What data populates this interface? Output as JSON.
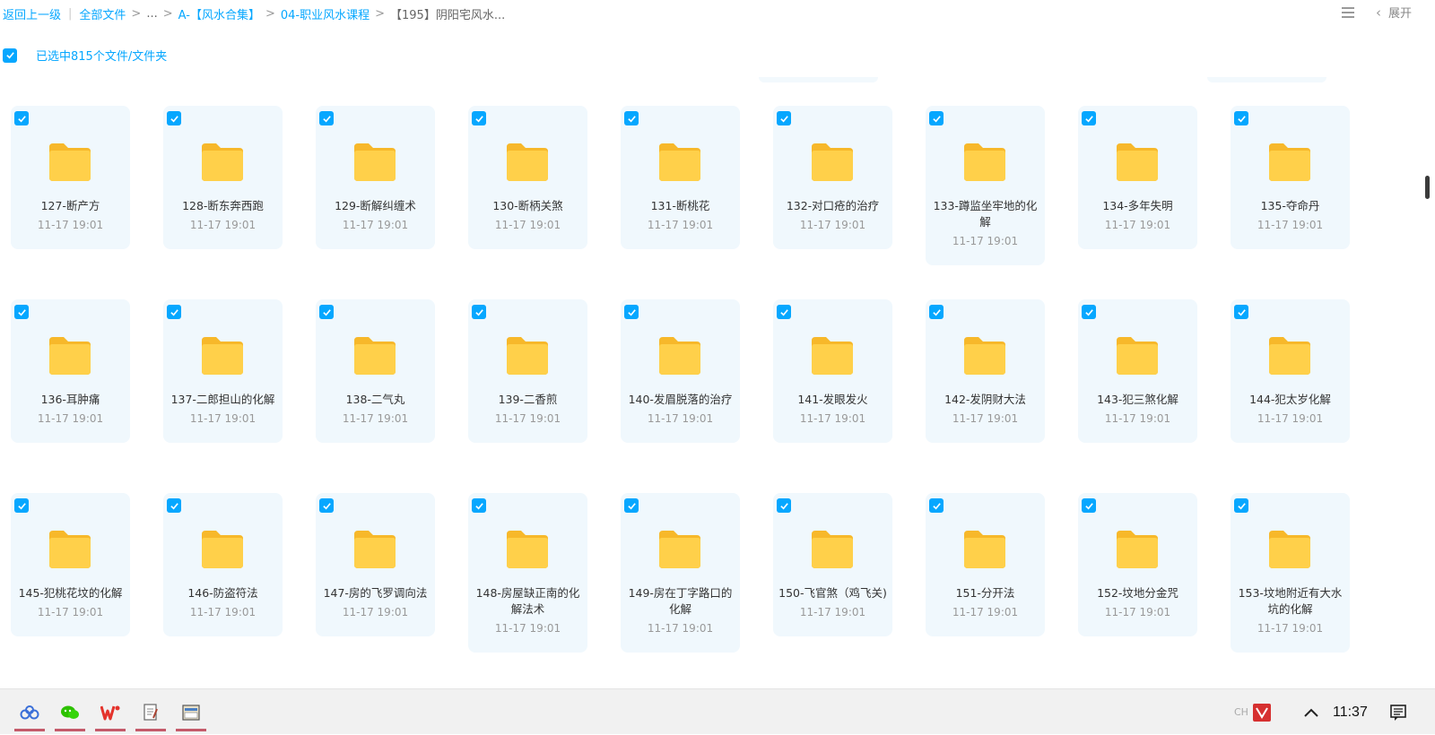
{
  "breadcrumb": {
    "back": "返回上一级",
    "root": "全部文件",
    "ellipsis": "...",
    "level1": "A-【风水合集】",
    "level2": "04-职业风水课程",
    "current": "【195】阴阳宅风水..."
  },
  "top_right": {
    "expand_label": "展开"
  },
  "selection": {
    "label": "已选中815个文件/文件夹"
  },
  "colors": {
    "accent": "#06a7ff",
    "card_bg": "#f0f8fd",
    "folder": "#ffc933"
  },
  "folders": [
    {
      "name": "127-断产方",
      "time": "11-17 19:01"
    },
    {
      "name": "128-断东奔西跑",
      "time": "11-17 19:01"
    },
    {
      "name": "129-断解纠缠术",
      "time": "11-17 19:01"
    },
    {
      "name": "130-断柄关煞",
      "time": "11-17 19:01"
    },
    {
      "name": "131-断桃花",
      "time": "11-17 19:01"
    },
    {
      "name": "132-对口疮的治疗",
      "time": "11-17 19:01"
    },
    {
      "name": "133-蹲监坐牢地的化解",
      "time": "11-17 19:01"
    },
    {
      "name": "134-多年失明",
      "time": "11-17 19:01"
    },
    {
      "name": "135-夺命丹",
      "time": "11-17 19:01"
    },
    {
      "name": "136-耳肿痛",
      "time": "11-17 19:01"
    },
    {
      "name": "137-二郎担山的化解",
      "time": "11-17 19:01"
    },
    {
      "name": "138-二气丸",
      "time": "11-17 19:01"
    },
    {
      "name": "139-二香煎",
      "time": "11-17 19:01"
    },
    {
      "name": "140-发眉脱落的治疗",
      "time": "11-17 19:01"
    },
    {
      "name": "141-发眼发火",
      "time": "11-17 19:01"
    },
    {
      "name": "142-发阴财大法",
      "time": "11-17 19:01"
    },
    {
      "name": "143-犯三煞化解",
      "time": "11-17 19:01"
    },
    {
      "name": "144-犯太岁化解",
      "time": "11-17 19:01"
    },
    {
      "name": "145-犯桃花坟的化解",
      "time": "11-17 19:01"
    },
    {
      "name": "146-防盗符法",
      "time": "11-17 19:01"
    },
    {
      "name": "147-房的飞罗调向法",
      "time": "11-17 19:01"
    },
    {
      "name": "148-房屋缺正南的化解法术",
      "time": "11-17 19:01"
    },
    {
      "name": "149-房在丁字路口的化解",
      "time": "11-17 19:01"
    },
    {
      "name": "150-飞官煞（鸡飞关)",
      "time": "11-17 19:01"
    },
    {
      "name": "151-分开法",
      "time": "11-17 19:01"
    },
    {
      "name": "152-坟地分金咒",
      "time": "11-17 19:01"
    },
    {
      "name": "153-坟地附近有大水坑的化解",
      "time": "11-17 19:01"
    }
  ],
  "taskbar": {
    "apps": [
      "baidu-netdisk-icon",
      "wechat-icon",
      "wps-icon",
      "notepad-icon",
      "file-manager-icon"
    ],
    "clock": "11:37"
  }
}
